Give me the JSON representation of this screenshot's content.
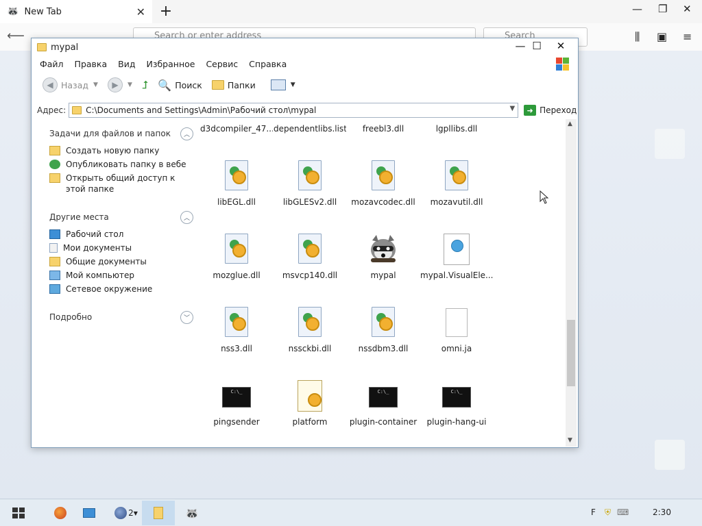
{
  "browser": {
    "tab_title": "New Tab",
    "url_placeholder": "Search or enter address",
    "search_placeholder": "Search",
    "icons": [
      "back-icon",
      "forward-icon",
      "reload-icon",
      "home-icon",
      "library-icon",
      "sidebar-icon",
      "menu-icon"
    ]
  },
  "window": {
    "title": "mypal",
    "menu": [
      "Файл",
      "Правка",
      "Вид",
      "Избранное",
      "Сервис",
      "Справка"
    ],
    "toolbar": {
      "back": "Назад",
      "search": "Поиск",
      "folders": "Папки"
    },
    "address": {
      "label": "Адрес:",
      "path": "C:\\Documents and Settings\\Admin\\Рабочий стол\\mypal",
      "go": "Переход"
    }
  },
  "leftpanel": {
    "tasks_title": "Задачи для файлов и папок",
    "tasks": [
      "Создать новую папку",
      "Опубликовать папку в вебе",
      "Открыть общий доступ к этой папке"
    ],
    "places_title": "Другие места",
    "places": [
      "Рабочий стол",
      "Мои документы",
      "Общие документы",
      "Мой компьютер",
      "Сетевое окружение"
    ],
    "details_title": "Подробно"
  },
  "files": [
    {
      "name": "d3dcompiler_47....",
      "type": "dll"
    },
    {
      "name": "dependentlibs.list",
      "type": "plain"
    },
    {
      "name": "freebl3.dll",
      "type": "dll"
    },
    {
      "name": "lgpllibs.dll",
      "type": "dll"
    },
    {
      "name": "libEGL.dll",
      "type": "dll"
    },
    {
      "name": "libGLESv2.dll",
      "type": "dll"
    },
    {
      "name": "mozavcodec.dll",
      "type": "dll"
    },
    {
      "name": "mozavutil.dll",
      "type": "dll"
    },
    {
      "name": "mozglue.dll",
      "type": "dll"
    },
    {
      "name": "msvcp140.dll",
      "type": "dll"
    },
    {
      "name": "mypal",
      "type": "app"
    },
    {
      "name": "mypal.VisualEle...",
      "type": "web"
    },
    {
      "name": "nss3.dll",
      "type": "dll"
    },
    {
      "name": "nssckbi.dll",
      "type": "dll"
    },
    {
      "name": "nssdbm3.dll",
      "type": "dll"
    },
    {
      "name": "omni.ja",
      "type": "plain"
    },
    {
      "name": "pingsender",
      "type": "console"
    },
    {
      "name": "platform",
      "type": "ini"
    },
    {
      "name": "plugin-container",
      "type": "console"
    },
    {
      "name": "plugin-hang-ui",
      "type": "console"
    }
  ],
  "taskbar": {
    "firefox_count": "2",
    "tray_lang": "F",
    "clock": "2:30"
  },
  "colors": {
    "accent": "#7f9db9",
    "folder": "#f7d26b",
    "taskbar": "#e4ecf3"
  }
}
